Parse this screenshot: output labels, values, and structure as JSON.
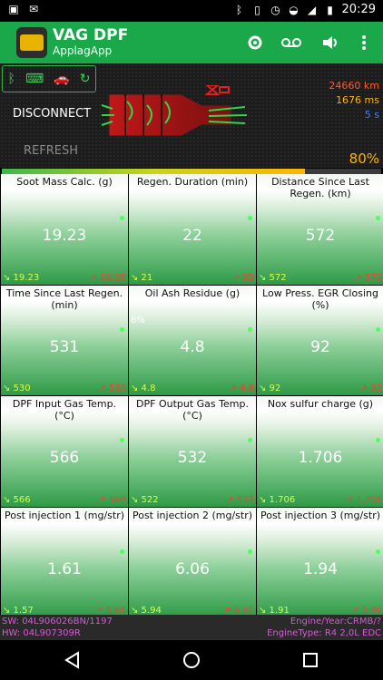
{
  "status_bar": {
    "time": "20:29",
    "battery": ""
  },
  "appbar": {
    "title": "VAG DPF",
    "subtitle": "ApplagApp"
  },
  "panel": {
    "disconnect_label": "DISCONNECT",
    "refresh_label": "REFRESH",
    "distance": "24660 km",
    "time_ms": "1676 ms",
    "interval": "5 s",
    "progress_percent": "80%",
    "progress_value": 0.8
  },
  "tiles": [
    {
      "label": "Soot Mass Calc. (g)",
      "value": "19.23",
      "min": "↘ 19.23",
      "max": "↗ 20.28"
    },
    {
      "label": "Regen. Duration (min)",
      "value": "22",
      "min": "↘ 21",
      "max": "↗ 22"
    },
    {
      "label": "Distance Since Last Regen. (km)",
      "value": "572",
      "min": "↘ 572",
      "max": "↗ 572"
    },
    {
      "label": "Time Since Last Regen. (min)",
      "value": "531",
      "min": "↘ 530",
      "max": "↗ 531"
    },
    {
      "label": "Oil Ash Residue (g)",
      "value": "4.8",
      "min": "↘ 4.8",
      "max": "↗ 4.8",
      "extra": "6%"
    },
    {
      "label": "Low Press. EGR Closing (%)",
      "value": "92",
      "min": "↘ 92",
      "max": "↗ 92"
    },
    {
      "label": "DPF Input Gas Temp. (°C)",
      "value": "566",
      "min": "↘ 566",
      "max": "↗ 569"
    },
    {
      "label": "DPF Output Gas Temp. (°C)",
      "value": "532",
      "min": "↘ 522",
      "max": "↗ 532"
    },
    {
      "label": "Nox sulfur charge (g)",
      "value": "1.706",
      "min": "↘ 1.706",
      "max": "↗ 1.706"
    },
    {
      "label": "Post injection 1 (mg/str)",
      "value": "1.61",
      "min": "↘ 1.57",
      "max": "↗ 1.66"
    },
    {
      "label": "Post injection 2 (mg/str)",
      "value": "6.06",
      "min": "↘ 5.94",
      "max": "↗ 6.11"
    },
    {
      "label": "Post injection 3 (mg/str)",
      "value": "1.94",
      "min": "↘ 1.91",
      "max": "↗ 1.96"
    }
  ],
  "footer": {
    "sw": "SW: 04L906026BN/1197",
    "hw": "HW: 04L907309R",
    "engine_year": "Engine/Year:CRMB/?",
    "engine_type": "EngineType: R4 2,0L EDC"
  }
}
